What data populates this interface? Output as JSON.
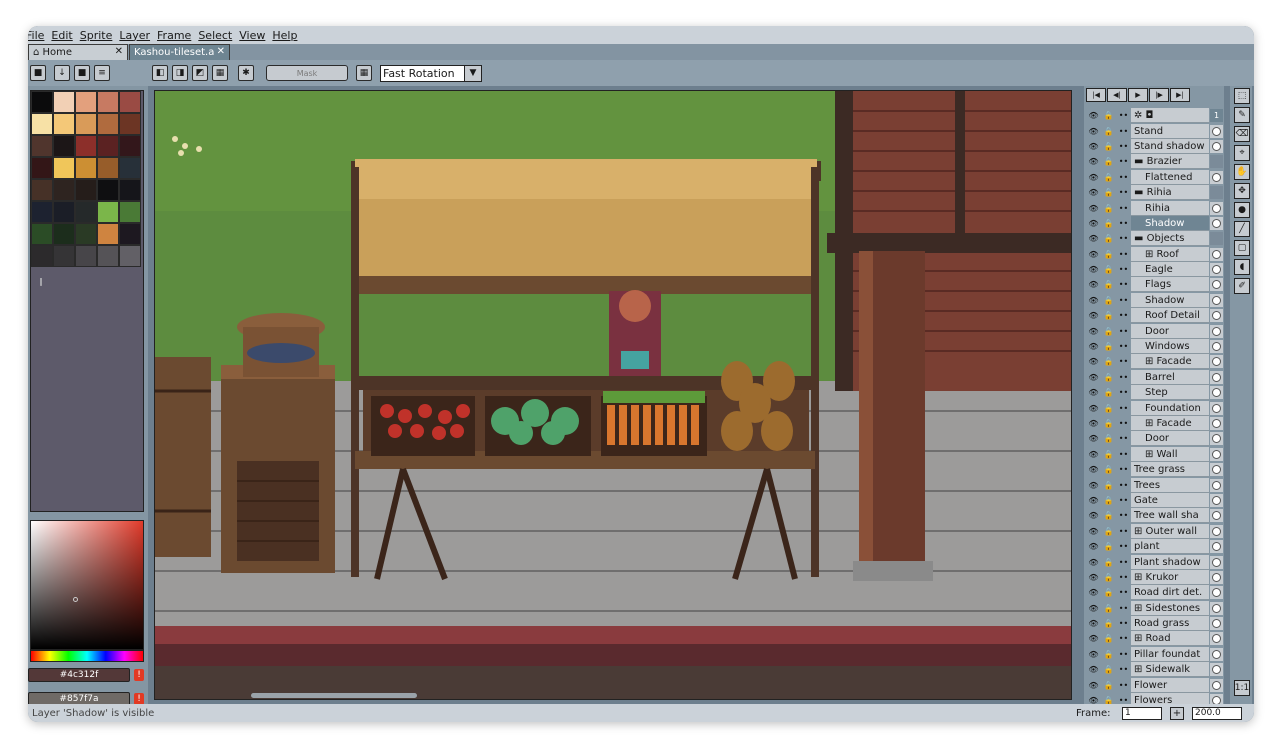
{
  "menu": [
    "File",
    "Edit",
    "Sprite",
    "Layer",
    "Frame",
    "Select",
    "View",
    "Help"
  ],
  "tabs": {
    "home": "Home",
    "file": "Kashou-tileset.a"
  },
  "toolbar": {
    "mask": "Mask",
    "rotation": "Fast Rotation"
  },
  "palette_colors": [
    "#0b0b0c",
    "#f2d0b5",
    "#e3a07d",
    "#c77a62",
    "#9a4b44",
    "#f7e1a6",
    "#f4c878",
    "#d99b59",
    "#b06b3e",
    "#6c3524",
    "#50352d",
    "#1c1617",
    "#8c2f2a",
    "#5b2222",
    "#33171b",
    "#331617",
    "#f0c65a",
    "#cc8f33",
    "#975d2a",
    "#273039",
    "#463127",
    "#2e2420",
    "#251d1a",
    "#0f0f11",
    "#15151a",
    "#1d2230",
    "#1b1e27",
    "#25292a",
    "#7bb64a",
    "#4a7a36",
    "#2b4c26",
    "#1c2d1c",
    "#2a3a25",
    "#cf8440",
    "#1d1820",
    "#2c2a2c",
    "#353436",
    "#474549",
    "#555357",
    "#626066"
  ],
  "colors": {
    "fg_hex": "#4c312f",
    "bg_hex": "#857f7a"
  },
  "status": "Layer 'Shadow' is visible",
  "frame_label": "Frame:",
  "frame_value": "1",
  "zoom_value": "200.0",
  "frame_number": "1",
  "layers": [
    {
      "name": "Stand"
    },
    {
      "name": "Stand shadow"
    },
    {
      "name": "Brazier",
      "group": true
    },
    {
      "name": "Flattened",
      "indent": 1
    },
    {
      "name": "Rihia",
      "group": true
    },
    {
      "name": "Rihia",
      "indent": 1
    },
    {
      "name": "Shadow",
      "indent": 1,
      "selected": true
    },
    {
      "name": "Objects",
      "group": true
    },
    {
      "name": "⊞ Roof",
      "indent": 1
    },
    {
      "name": "Eagle",
      "indent": 1
    },
    {
      "name": "Flags",
      "indent": 1
    },
    {
      "name": "Shadow",
      "indent": 1
    },
    {
      "name": "Roof Detail",
      "indent": 1
    },
    {
      "name": "Door",
      "indent": 1
    },
    {
      "name": "Windows",
      "indent": 1
    },
    {
      "name": "⊞ Facade",
      "indent": 1
    },
    {
      "name": "Barrel",
      "indent": 1
    },
    {
      "name": "Step",
      "indent": 1
    },
    {
      "name": "Foundation",
      "indent": 1
    },
    {
      "name": "⊞ Facade",
      "indent": 1
    },
    {
      "name": "Door",
      "indent": 1
    },
    {
      "name": "⊞ Wall",
      "indent": 1
    },
    {
      "name": "Tree grass"
    },
    {
      "name": "Trees"
    },
    {
      "name": "Gate"
    },
    {
      "name": "Tree wall sha"
    },
    {
      "name": "⊞ Outer wall"
    },
    {
      "name": "plant"
    },
    {
      "name": "Plant shadow"
    },
    {
      "name": "⊞ Krukor"
    },
    {
      "name": "Road dirt det."
    },
    {
      "name": "⊞ Sidestones"
    },
    {
      "name": "Road grass"
    },
    {
      "name": "⊞ Road"
    },
    {
      "name": "Pillar foundat"
    },
    {
      "name": "⊞ Sidewalk"
    },
    {
      "name": "Flower"
    },
    {
      "name": "Flowers"
    }
  ]
}
